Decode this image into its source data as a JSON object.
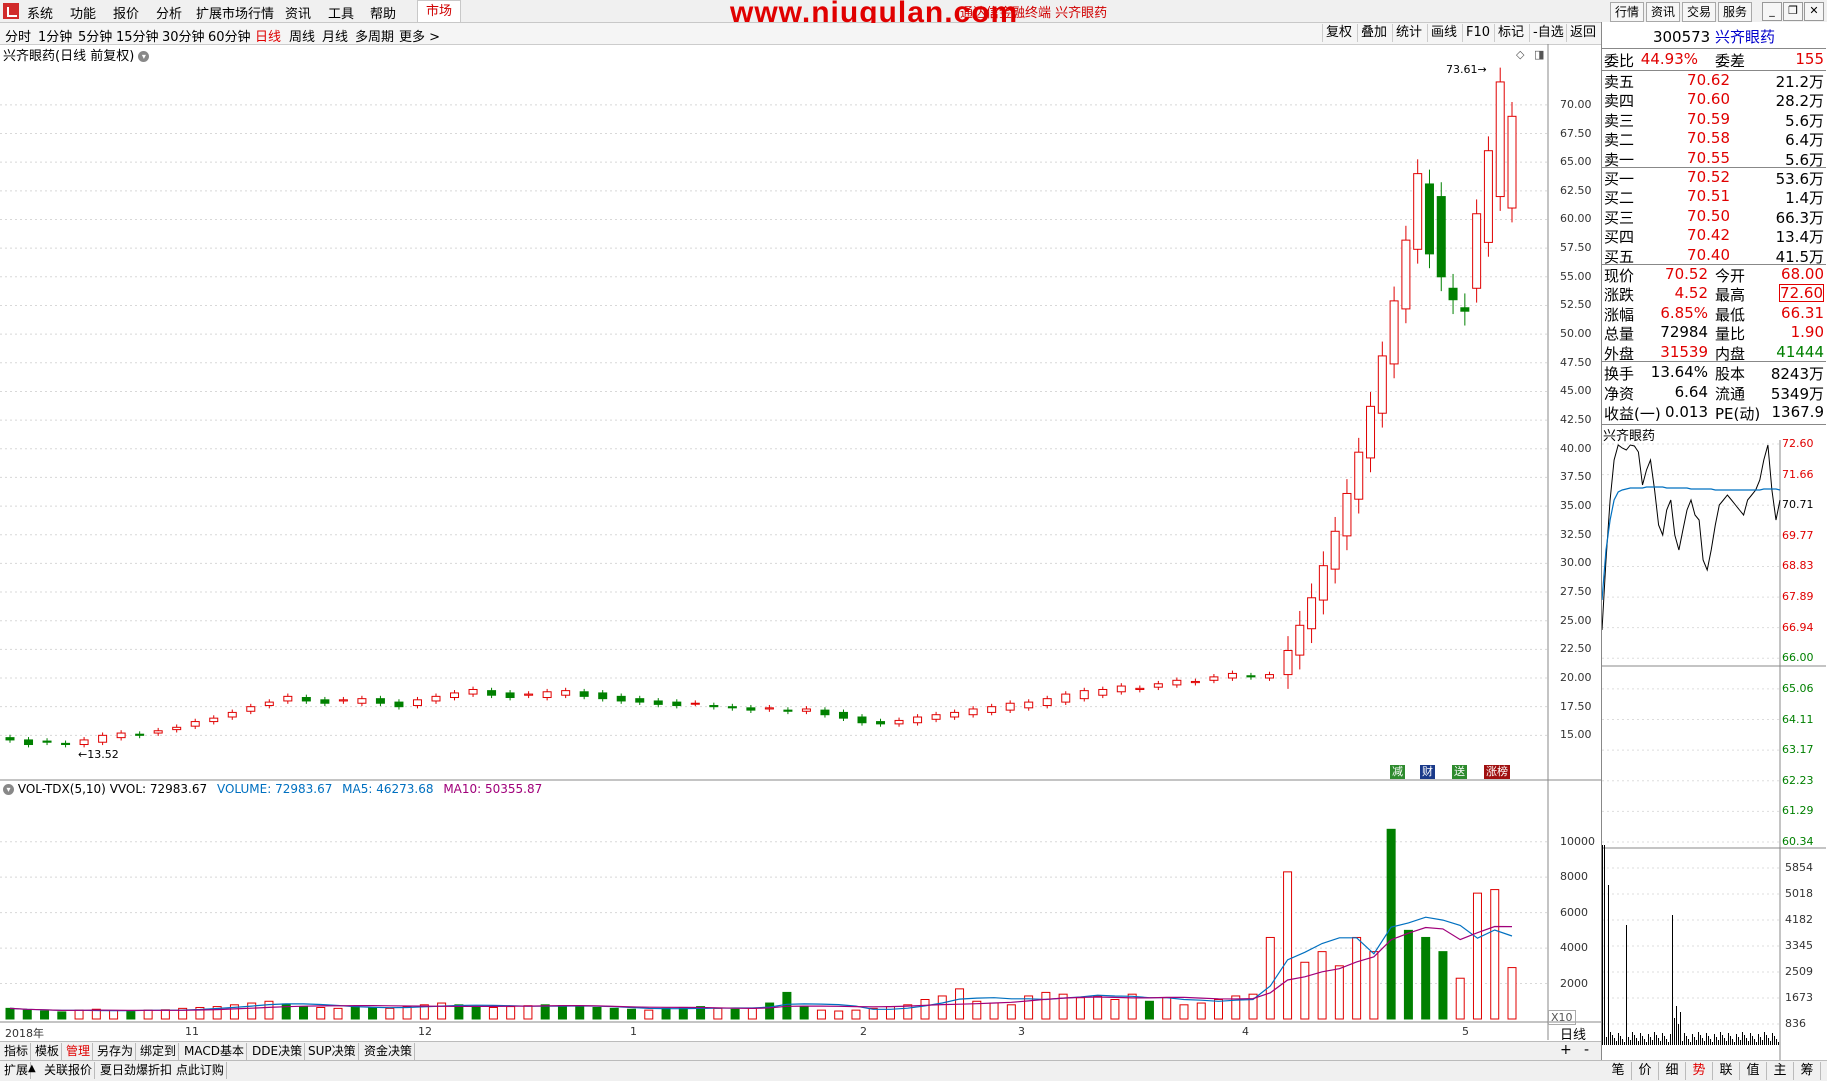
{
  "menubar": {
    "items": [
      "系统",
      "功能",
      "报价",
      "分析",
      "扩展市场行情",
      "资讯",
      "工具",
      "帮助"
    ],
    "market_tab": "市场",
    "watermark": "www.niugulan.com",
    "window_title": "通达信金融终端  兴齐眼药",
    "right_buttons": [
      "行情",
      "资讯",
      "交易",
      "服务"
    ]
  },
  "periodbar": {
    "periods": [
      "分时",
      "1分钟",
      "5分钟",
      "15分钟",
      "30分钟",
      "60分钟",
      "日线",
      "周线",
      "月线",
      "多周期",
      "更多 >"
    ],
    "active": "日线",
    "tools": [
      "复权",
      "叠加",
      "统计",
      "画线",
      "F10",
      "标记",
      "-自选",
      "返回"
    ]
  },
  "main_chart": {
    "title": "兴齐眼药(日线 前复权)",
    "price_labels": [
      "70.00",
      "67.50",
      "65.00",
      "62.50",
      "60.00",
      "57.50",
      "55.00",
      "52.50",
      "50.00",
      "47.50",
      "45.00",
      "42.50",
      "40.00",
      "37.50",
      "35.00",
      "32.50",
      "30.00",
      "27.50",
      "25.00",
      "22.50",
      "20.00",
      "17.50",
      "15.00"
    ],
    "low_annotation": "13.52",
    "high_annotation": "73.61",
    "badges": [
      "减",
      "财",
      "送",
      "涨榜"
    ],
    "badge_colors": [
      "#2e8b2e",
      "#1a3a8a",
      "#2e8b2e",
      "#a01010"
    ]
  },
  "volume_chart": {
    "indicator": "VOL-TDX(5,10)",
    "vvol": "VVOL: 72983.67",
    "volume": "VOLUME: 72983.67",
    "ma5": "MA5: 46273.68",
    "ma10": "MA10: 50355.87",
    "vol_labels": [
      "10000",
      "8000",
      "6000",
      "4000",
      "2000"
    ],
    "multiplier": "X10"
  },
  "date_axis": {
    "labels": [
      "2018年",
      "11",
      "12",
      "1",
      "2",
      "3",
      "4",
      "5"
    ],
    "period_label": "日线"
  },
  "chart_data": {
    "type": "candlestick",
    "ylim": [
      12.5,
      74
    ],
    "opens": [
      14.8,
      14.6,
      14.5,
      14.3,
      14.2,
      14.4,
      14.8,
      15.1,
      15.2,
      15.5,
      15.8,
      16.2,
      16.6,
      17.1,
      17.6,
      18.0,
      18.3,
      18.1,
      18.0,
      17.8,
      18.2,
      17.9,
      17.6,
      18.0,
      18.3,
      18.6,
      18.9,
      18.7,
      18.5,
      18.3,
      18.5,
      18.8,
      18.7,
      18.4,
      18.2,
      18.0,
      17.9,
      17.8,
      17.6,
      17.5,
      17.4,
      17.3,
      17.2,
      17.1,
      17.2,
      17.0,
      16.6,
      16.2,
      16.0,
      16.1,
      16.4,
      16.6,
      16.8,
      17.0,
      17.2,
      17.4,
      17.6,
      17.9,
      18.2,
      18.5,
      18.8,
      19.0,
      19.2,
      19.4,
      19.6,
      19.8,
      20.0,
      20.2,
      20.0
    ],
    "closes": [
      14.6,
      14.2,
      14.4,
      14.2,
      14.6,
      15.0,
      15.2,
      15.0,
      15.4,
      15.7,
      16.2,
      16.5,
      17.0,
      17.5,
      17.9,
      18.4,
      18.0,
      17.8,
      18.1,
      18.2,
      17.8,
      17.5,
      18.1,
      18.4,
      18.7,
      19.0,
      18.5,
      18.3,
      18.6,
      18.8,
      18.9,
      18.4,
      18.2,
      18.0,
      17.9,
      17.7,
      17.6,
      17.8,
      17.5,
      17.4,
      17.2,
      17.4,
      17.1,
      17.3,
      16.8,
      16.5,
      16.1,
      16.0,
      16.3,
      16.6,
      16.8,
      17.0,
      17.3,
      17.5,
      17.8,
      17.9,
      18.2,
      18.6,
      18.9,
      19.0,
      19.3,
      19.1,
      19.5,
      19.8,
      19.7,
      20.1,
      20.4,
      20.1,
      20.3
    ],
    "tail_dates": [
      "4月",
      "",
      "",
      "",
      "",
      "",
      "",
      "",
      "",
      "",
      "",
      "",
      "",
      "",
      "",
      "",
      "",
      "",
      "5月"
    ],
    "tail_opens": [
      20.3,
      22.0,
      24.3,
      26.8,
      29.5,
      32.4,
      35.6,
      39.2,
      43.1,
      47.4,
      52.2,
      57.4,
      63.1,
      62.0,
      54.0,
      52.3,
      54.0,
      58.0,
      62.0,
      61.0
    ],
    "tail_closes": [
      22.4,
      24.6,
      27.0,
      29.8,
      32.8,
      36.1,
      39.7,
      43.7,
      48.1,
      52.9,
      58.2,
      64.0,
      57.0,
      55.0,
      53.0,
      52.0,
      60.5,
      66.0,
      72.0,
      69.0
    ],
    "volumes": [
      600,
      500,
      450,
      400,
      500,
      550,
      480,
      420,
      500,
      520,
      600,
      650,
      700,
      800,
      900,
      1000,
      850,
      700,
      650,
      600,
      700,
      650,
      600,
      700,
      800,
      900,
      800,
      700,
      650,
      700,
      750,
      800,
      750,
      700,
      650,
      600,
      550,
      500,
      600,
      650,
      700,
      600,
      550,
      600,
      900,
      1500,
      700,
      500,
      450,
      500,
      600,
      700,
      800,
      1100,
      1300,
      1700,
      1000,
      900,
      800,
      1300,
      1500,
      1400,
      1200,
      1300,
      1100,
      1400,
      1000,
      1200,
      800,
      900,
      1100,
      1300,
      1400,
      4600,
      8300,
      3200,
      3800,
      3000,
      4600,
      3800,
      10700,
      5000,
      4600,
      3800,
      2300,
      7100,
      7300,
      2900
    ],
    "ma5_color": "#0070c0",
    "ma10_color": "#a0007a",
    "up_color": "#e00000",
    "down_color": "#008000"
  },
  "quote_panel": {
    "code": "300573",
    "name": "兴齐眼药",
    "weibi_label": "委比",
    "weibi": "44.93%",
    "weicha_label": "委差",
    "weicha": "155",
    "sell": [
      {
        "label": "卖五",
        "price": "70.62",
        "vol": "21.2万"
      },
      {
        "label": "卖四",
        "price": "70.60",
        "vol": "28.2万"
      },
      {
        "label": "卖三",
        "price": "70.59",
        "vol": "5.6万"
      },
      {
        "label": "卖二",
        "price": "70.58",
        "vol": "6.4万"
      },
      {
        "label": "卖一",
        "price": "70.55",
        "vol": "5.6万"
      }
    ],
    "buy": [
      {
        "label": "买一",
        "price": "70.52",
        "vol": "53.6万"
      },
      {
        "label": "买二",
        "price": "70.51",
        "vol": "1.4万"
      },
      {
        "label": "买三",
        "price": "70.50",
        "vol": "66.3万"
      },
      {
        "label": "买四",
        "price": "70.42",
        "vol": "13.4万"
      },
      {
        "label": "买五",
        "price": "70.40",
        "vol": "41.5万"
      }
    ],
    "stats": [
      {
        "l": "现价",
        "v": "70.52",
        "vc": "red",
        "l2": "今开",
        "v2": "68.00",
        "v2c": "red"
      },
      {
        "l": "涨跌",
        "v": "4.52",
        "vc": "red",
        "l2": "最高",
        "v2": "72.60",
        "v2c": "red"
      },
      {
        "l": "涨幅",
        "v": "6.85%",
        "vc": "red",
        "l2": "最低",
        "v2": "66.31",
        "v2c": "red"
      },
      {
        "l": "总量",
        "v": "72984",
        "vc": "black",
        "l2": "量比",
        "v2": "1.90",
        "v2c": "red"
      },
      {
        "l": "外盘",
        "v": "31539",
        "vc": "red",
        "l2": "内盘",
        "v2": "41444",
        "v2c": "green"
      }
    ],
    "stats2": [
      {
        "l": "换手",
        "v": "13.64%",
        "l2": "股本",
        "v2": "8243万"
      },
      {
        "l": "净资",
        "v": "6.64",
        "l2": "流通",
        "v2": "5349万"
      },
      {
        "l": "收益(一)",
        "v": "0.013",
        "l2": "PE(动)",
        "v2": "1367.9"
      }
    ]
  },
  "mini_chart": {
    "title": "兴齐眼药",
    "price_labels": [
      "72.60",
      "71.66",
      "70.71",
      "69.77",
      "68.83",
      "67.89",
      "66.94",
      "66.00",
      "65.06",
      "64.11",
      "63.17",
      "62.23",
      "61.29",
      "60.34"
    ],
    "vol_labels": [
      "5854",
      "5018",
      "4182",
      "3345",
      "2509",
      "1673",
      "836"
    ]
  },
  "bottom_tabs1": [
    "指标",
    "模板",
    "管理",
    "另存为",
    "绑定到",
    "MACD基本",
    "DDE决策",
    "SUP决策",
    "资金决策"
  ],
  "bottom_tabs2": [
    "扩展",
    "关联报价",
    "夏日劲爆折扣 点此订购"
  ],
  "right_tabs": [
    "笔",
    "价",
    "细",
    "势",
    "联",
    "值",
    "主",
    "筹"
  ]
}
